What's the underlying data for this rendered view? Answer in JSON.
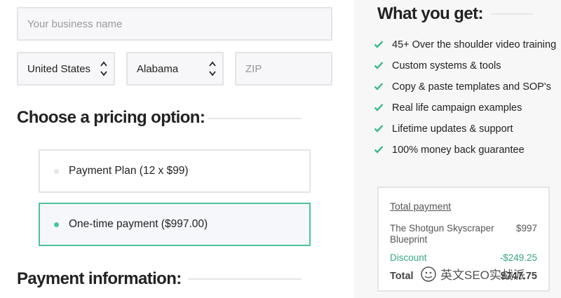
{
  "form": {
    "business_placeholder": "Your business name",
    "country_value": "United States",
    "state_value": "Alabama",
    "zip_placeholder": "ZIP"
  },
  "pricing": {
    "heading": "Choose a pricing option:",
    "options": [
      {
        "label": "Payment Plan (12 x $99)",
        "selected": false
      },
      {
        "label": "One-time payment ($997.00)",
        "selected": true
      }
    ]
  },
  "payment_info": {
    "heading": "Payment information:"
  },
  "benefits": {
    "heading": "What you get:",
    "items": [
      "45+ Over the shoulder video training",
      "Custom systems & tools",
      "Copy & paste templates and SOP's",
      "Real life campaign examples",
      "Lifetime updates & support",
      "100% money back guarantee"
    ]
  },
  "summary": {
    "title": "Total payment",
    "product_label": "The Shotgun Skyscraper Blueprint",
    "product_amount": "$997",
    "discount_label": "Discount",
    "discount_amount": "-$249.25",
    "total_label": "Total",
    "total_amount": "$747.75"
  },
  "watermark": {
    "text": "英文SEO实战派"
  },
  "colors": {
    "accent": "#4cc39a",
    "check": "#3dbb8e",
    "discount": "#37a87f"
  },
  "icons": {
    "select": "chevron-up-down-icon",
    "check": "check-icon",
    "watermark": "wechat-logo-icon"
  }
}
